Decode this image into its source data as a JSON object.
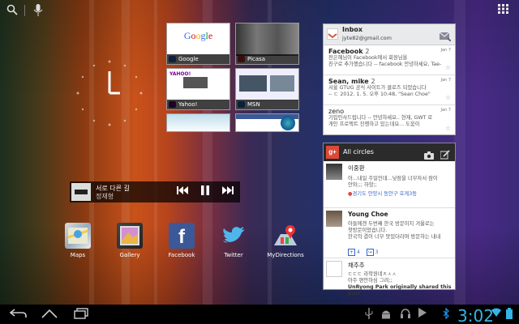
{
  "topbar": {
    "search_icon": "search-icon",
    "mic_icon": "mic-icon",
    "apps_icon": "apps-grid-icon"
  },
  "bookmarks": [
    {
      "label": "Google"
    },
    {
      "label": "Picasa"
    },
    {
      "label": "Yahoo!"
    },
    {
      "label": "MSN"
    },
    {
      "label": ""
    },
    {
      "label": ""
    }
  ],
  "music": {
    "title": "서로 다른 길",
    "artist": "정재형"
  },
  "apps": [
    {
      "label": "Maps"
    },
    {
      "label": "Gallery"
    },
    {
      "label": "Facebook"
    },
    {
      "label": "Twitter"
    },
    {
      "label": "MyDirections"
    }
  ],
  "inbox": {
    "title": "Inbox",
    "account": "jyte82@gmail.com",
    "messages": [
      {
        "sender": "Facebook",
        "count": "2",
        "date": "Jan 7",
        "line1": "전은혜님이 Facebook에서 회원님을",
        "line2": "친구로 추가했습니다 -- facebook 안녕하세요, Tae-"
      },
      {
        "sender": "Sean, mike",
        "count": "2",
        "date": "Jan 7",
        "line1": "서울 GTUG 공식 사이트가 클로즈 되었습니다",
        "line2": "-- ㄷ 2012. 1. 5. 오후 10:48, \"Sean Choe\""
      },
      {
        "sender": "zeno",
        "count": "",
        "date": "Jan 7",
        "line1": "기입민사드립니다 -- 안녕하세요.. 현재, GWT 로",
        "line2": "개인 프로젝트 진행하고 있는데요... 도움이"
      }
    ]
  },
  "gplus": {
    "title": "All circles",
    "posts": [
      {
        "name": "이중환",
        "line1": "아...내일 주일인데...낮잠을 너무자서 잠이",
        "line2": "안와;;; 하핫;;",
        "location": "경기도 안양시 동안구 호계3동"
      },
      {
        "name": "Young Choe",
        "line1": "아들에겐 두번째 한국 방문이지 겨울로는",
        "line2": "첫방문이었습니다.",
        "line3": "한국의 결이 너무 맛있더라며 방문하는 내내",
        "plus": "4",
        "shares": "3"
      },
      {
        "name": "채추추",
        "line1": "ㄷㄷㄷ 라학원네ㅈㅅㅅ",
        "line2": "아주 편안하심 그려;;",
        "line3": "UnRyong Park originally shared this post"
      }
    ]
  },
  "status": {
    "time": "3:02"
  },
  "colors": {
    "google_red": "#db4a39",
    "blue": "#1e88e5"
  }
}
